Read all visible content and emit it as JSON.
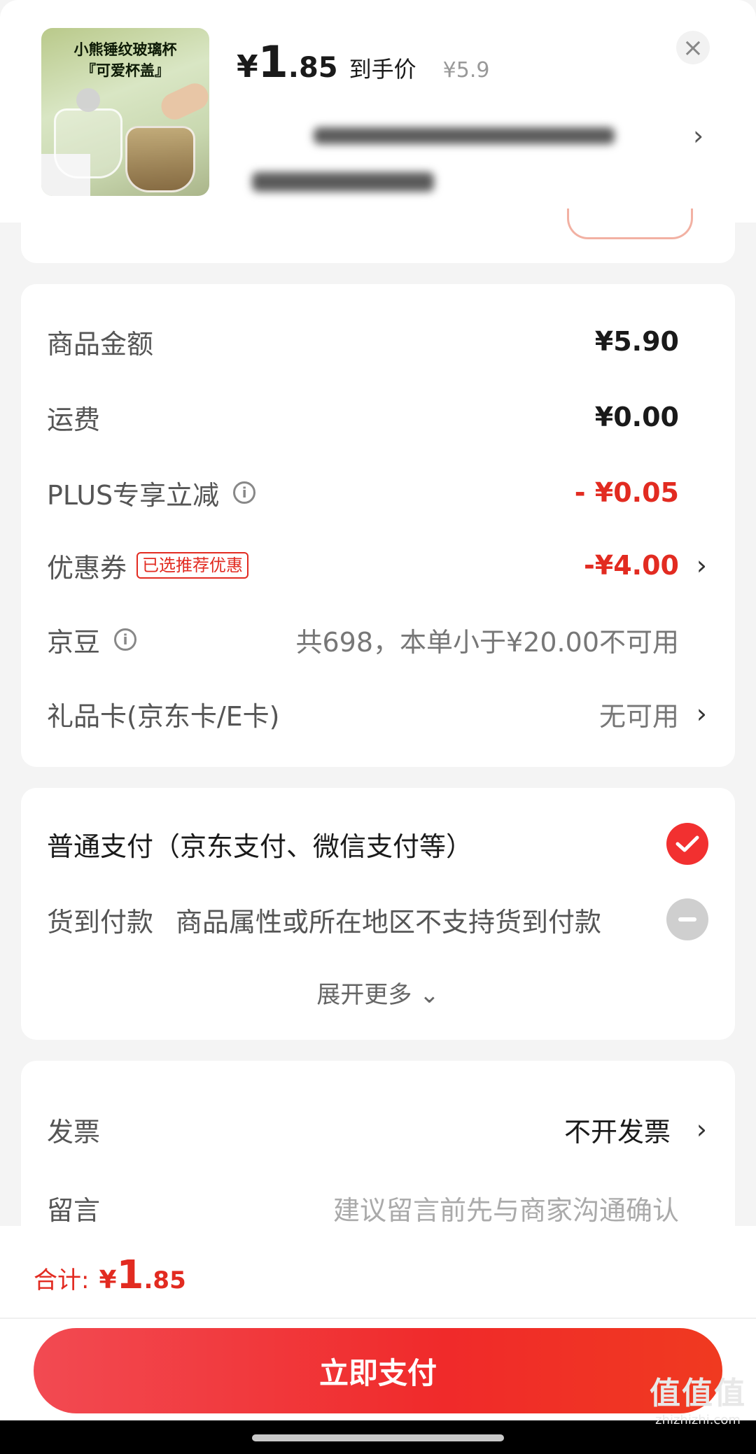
{
  "product": {
    "image_caption_line1": "小熊锤纹玻璃杯",
    "image_caption_line2": "『可爱杯盖』",
    "currency": "¥",
    "price_int": "1",
    "price_dec": ".85",
    "price_tag": "到手价",
    "original_price": "¥5.9",
    "close_icon": "close-icon",
    "spec_chevron": "›"
  },
  "summary": {
    "rows": [
      {
        "label": "商品金额",
        "value": "¥5.90"
      },
      {
        "label": "运费",
        "value": "¥0.00"
      },
      {
        "label": "PLUS专享立减",
        "value": "- ¥0.05"
      },
      {
        "label": "优惠券",
        "badge": "已选推荐优惠",
        "value": "-¥4.00"
      },
      {
        "label": "京豆",
        "value": "共698，本单小于¥20.00不可用"
      },
      {
        "label": "礼品卡(京东卡/E卡)",
        "value": "无可用"
      }
    ],
    "chevron": "›",
    "info_glyph": "i"
  },
  "payment": {
    "normal_label": "普通支付（京东支付、微信支付等）",
    "cod_label": "货到付款",
    "cod_note": "商品属性或所在地区不支持货到付款",
    "expand_label": "展开更多 ⌄"
  },
  "extra": {
    "invoice_label": "发票",
    "invoice_value": "不开发票",
    "message_label": "留言",
    "message_placeholder": "建议留言前先与商家沟通确认"
  },
  "footer": {
    "total_label": "合计:",
    "currency": "¥",
    "total_int": "1",
    "total_dec": ".85",
    "pay_button": "立即支付"
  },
  "watermark": {
    "big": "值值值",
    "small": "zhizhizhi.com"
  },
  "colors": {
    "accent_red": "#e22b21",
    "button_red": "#f02a2a",
    "background": "#f4f4f4"
  }
}
